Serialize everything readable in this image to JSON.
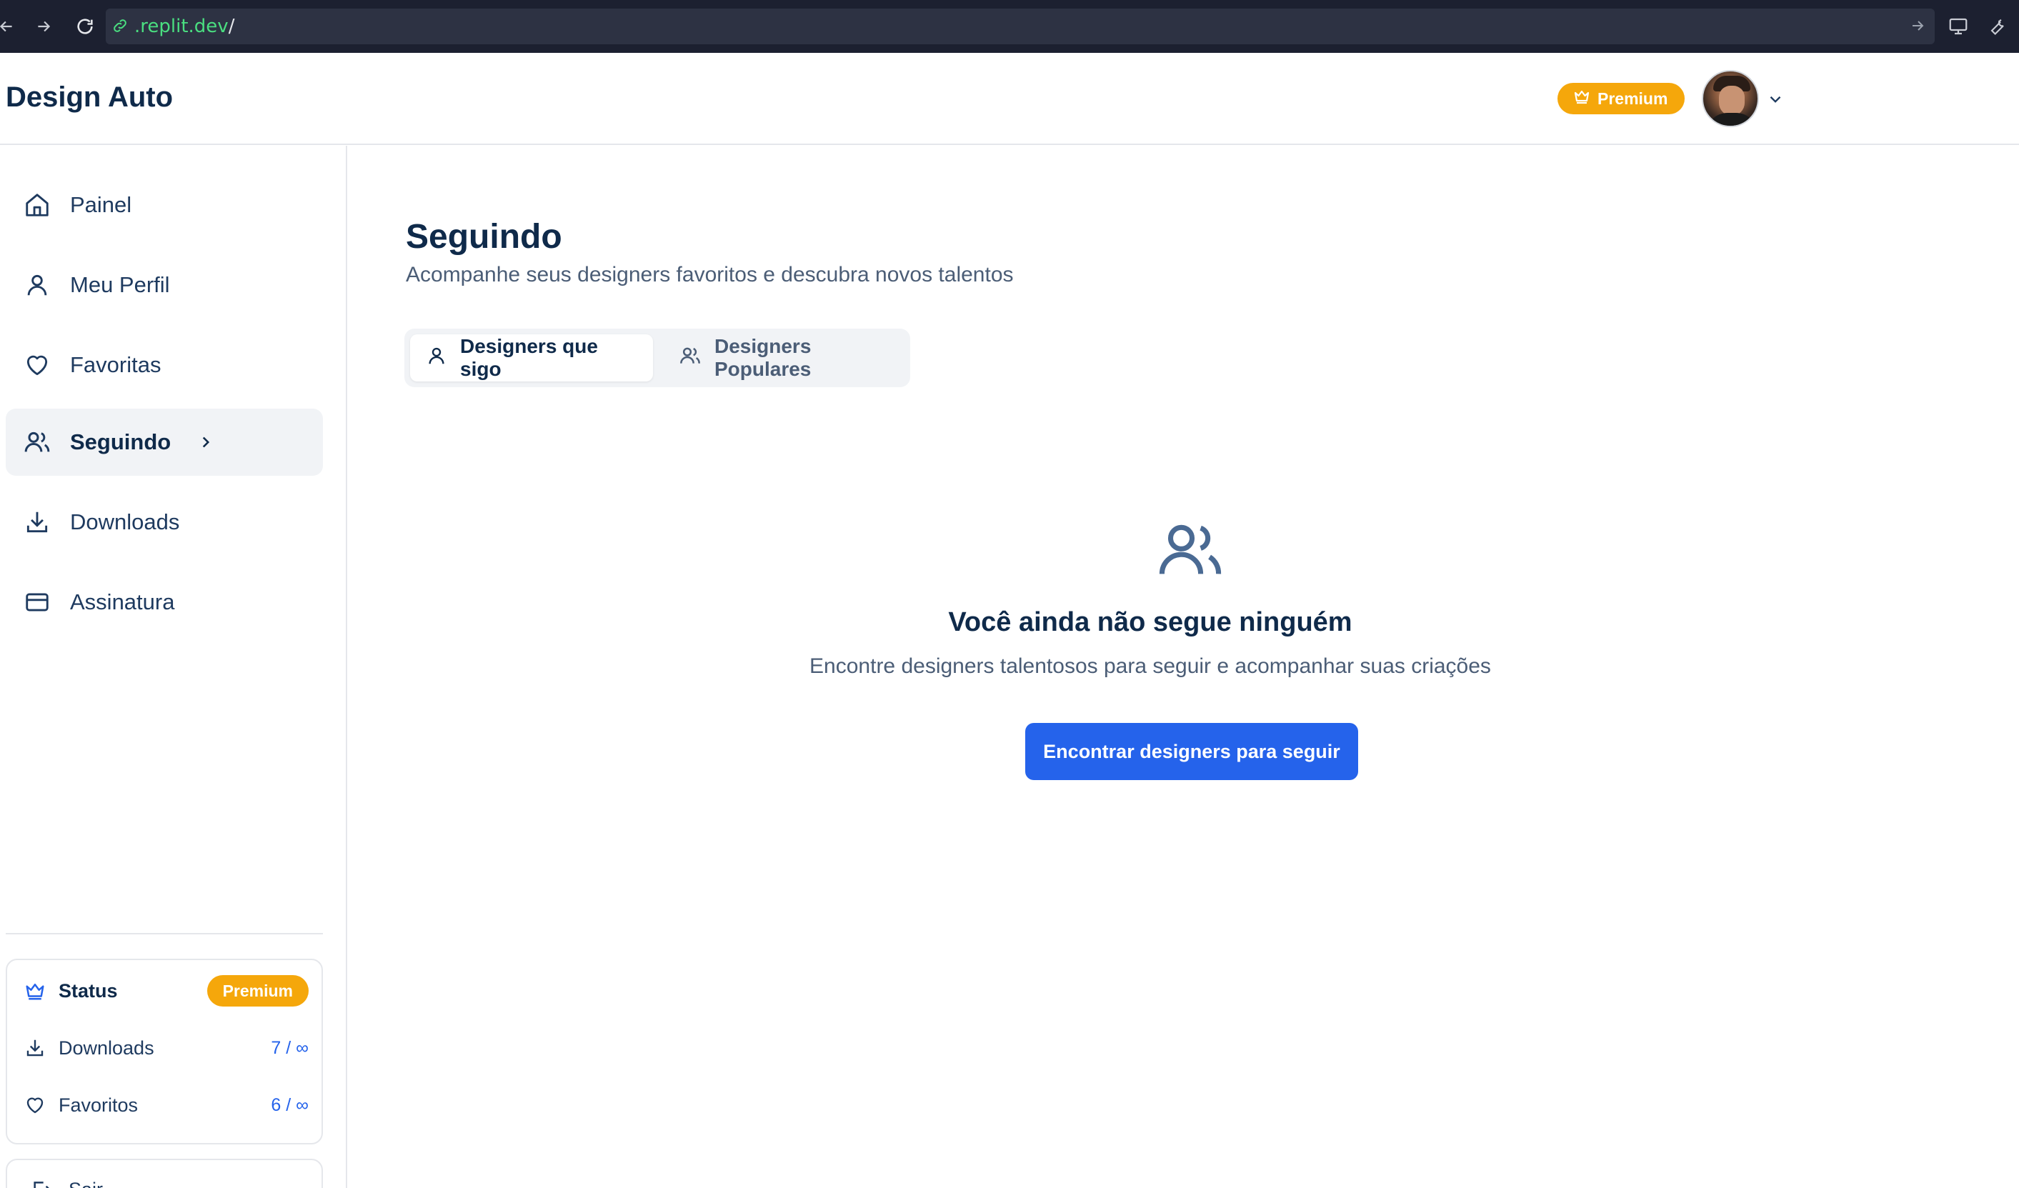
{
  "browser": {
    "url_host": ".replit.dev",
    "url_path": "/"
  },
  "header": {
    "brand": "Design Auto",
    "premium_label": "Premium"
  },
  "sidebar": {
    "items": [
      {
        "label": "Painel",
        "icon": "home-icon"
      },
      {
        "label": "Meu Perfil",
        "icon": "user-icon"
      },
      {
        "label": "Favoritas",
        "icon": "heart-icon"
      },
      {
        "label": "Seguindo",
        "icon": "users-icon",
        "active": true
      },
      {
        "label": "Downloads",
        "icon": "download-icon"
      },
      {
        "label": "Assinatura",
        "icon": "credit-card-icon"
      }
    ],
    "status": {
      "title": "Status",
      "badge": "Premium",
      "downloads_label": "Downloads",
      "downloads_value": "7 / ∞",
      "favorites_label": "Favoritos",
      "favorites_value": "6 / ∞"
    },
    "logout_label": "Sair"
  },
  "main": {
    "title": "Seguindo",
    "subtitle": "Acompanhe seus designers favoritos e descubra novos talentos",
    "tabs": [
      {
        "label": "Designers que sigo",
        "active": true
      },
      {
        "label": "Designers Populares",
        "active": false
      }
    ],
    "empty": {
      "title": "Você ainda não segue ninguém",
      "description": "Encontre designers talentosos para seguir e acompanhar suas criações",
      "cta": "Encontrar designers para seguir"
    }
  },
  "colors": {
    "accent": "#2563eb",
    "premium": "#f5a70b",
    "heading": "#0f2a4a"
  }
}
